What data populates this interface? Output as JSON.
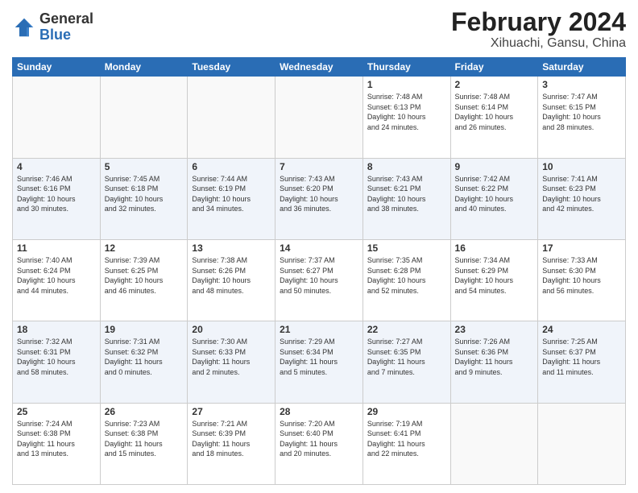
{
  "header": {
    "logo_general": "General",
    "logo_blue": "Blue",
    "title": "February 2024",
    "subtitle": "Xihuachi, Gansu, China"
  },
  "days_of_week": [
    "Sunday",
    "Monday",
    "Tuesday",
    "Wednesday",
    "Thursday",
    "Friday",
    "Saturday"
  ],
  "weeks": [
    {
      "stripe": false,
      "days": [
        {
          "num": "",
          "info": ""
        },
        {
          "num": "",
          "info": ""
        },
        {
          "num": "",
          "info": ""
        },
        {
          "num": "",
          "info": ""
        },
        {
          "num": "1",
          "info": "Sunrise: 7:48 AM\nSunset: 6:13 PM\nDaylight: 10 hours\nand 24 minutes."
        },
        {
          "num": "2",
          "info": "Sunrise: 7:48 AM\nSunset: 6:14 PM\nDaylight: 10 hours\nand 26 minutes."
        },
        {
          "num": "3",
          "info": "Sunrise: 7:47 AM\nSunset: 6:15 PM\nDaylight: 10 hours\nand 28 minutes."
        }
      ]
    },
    {
      "stripe": true,
      "days": [
        {
          "num": "4",
          "info": "Sunrise: 7:46 AM\nSunset: 6:16 PM\nDaylight: 10 hours\nand 30 minutes."
        },
        {
          "num": "5",
          "info": "Sunrise: 7:45 AM\nSunset: 6:18 PM\nDaylight: 10 hours\nand 32 minutes."
        },
        {
          "num": "6",
          "info": "Sunrise: 7:44 AM\nSunset: 6:19 PM\nDaylight: 10 hours\nand 34 minutes."
        },
        {
          "num": "7",
          "info": "Sunrise: 7:43 AM\nSunset: 6:20 PM\nDaylight: 10 hours\nand 36 minutes."
        },
        {
          "num": "8",
          "info": "Sunrise: 7:43 AM\nSunset: 6:21 PM\nDaylight: 10 hours\nand 38 minutes."
        },
        {
          "num": "9",
          "info": "Sunrise: 7:42 AM\nSunset: 6:22 PM\nDaylight: 10 hours\nand 40 minutes."
        },
        {
          "num": "10",
          "info": "Sunrise: 7:41 AM\nSunset: 6:23 PM\nDaylight: 10 hours\nand 42 minutes."
        }
      ]
    },
    {
      "stripe": false,
      "days": [
        {
          "num": "11",
          "info": "Sunrise: 7:40 AM\nSunset: 6:24 PM\nDaylight: 10 hours\nand 44 minutes."
        },
        {
          "num": "12",
          "info": "Sunrise: 7:39 AM\nSunset: 6:25 PM\nDaylight: 10 hours\nand 46 minutes."
        },
        {
          "num": "13",
          "info": "Sunrise: 7:38 AM\nSunset: 6:26 PM\nDaylight: 10 hours\nand 48 minutes."
        },
        {
          "num": "14",
          "info": "Sunrise: 7:37 AM\nSunset: 6:27 PM\nDaylight: 10 hours\nand 50 minutes."
        },
        {
          "num": "15",
          "info": "Sunrise: 7:35 AM\nSunset: 6:28 PM\nDaylight: 10 hours\nand 52 minutes."
        },
        {
          "num": "16",
          "info": "Sunrise: 7:34 AM\nSunset: 6:29 PM\nDaylight: 10 hours\nand 54 minutes."
        },
        {
          "num": "17",
          "info": "Sunrise: 7:33 AM\nSunset: 6:30 PM\nDaylight: 10 hours\nand 56 minutes."
        }
      ]
    },
    {
      "stripe": true,
      "days": [
        {
          "num": "18",
          "info": "Sunrise: 7:32 AM\nSunset: 6:31 PM\nDaylight: 10 hours\nand 58 minutes."
        },
        {
          "num": "19",
          "info": "Sunrise: 7:31 AM\nSunset: 6:32 PM\nDaylight: 11 hours\nand 0 minutes."
        },
        {
          "num": "20",
          "info": "Sunrise: 7:30 AM\nSunset: 6:33 PM\nDaylight: 11 hours\nand 2 minutes."
        },
        {
          "num": "21",
          "info": "Sunrise: 7:29 AM\nSunset: 6:34 PM\nDaylight: 11 hours\nand 5 minutes."
        },
        {
          "num": "22",
          "info": "Sunrise: 7:27 AM\nSunset: 6:35 PM\nDaylight: 11 hours\nand 7 minutes."
        },
        {
          "num": "23",
          "info": "Sunrise: 7:26 AM\nSunset: 6:36 PM\nDaylight: 11 hours\nand 9 minutes."
        },
        {
          "num": "24",
          "info": "Sunrise: 7:25 AM\nSunset: 6:37 PM\nDaylight: 11 hours\nand 11 minutes."
        }
      ]
    },
    {
      "stripe": false,
      "days": [
        {
          "num": "25",
          "info": "Sunrise: 7:24 AM\nSunset: 6:38 PM\nDaylight: 11 hours\nand 13 minutes."
        },
        {
          "num": "26",
          "info": "Sunrise: 7:23 AM\nSunset: 6:38 PM\nDaylight: 11 hours\nand 15 minutes."
        },
        {
          "num": "27",
          "info": "Sunrise: 7:21 AM\nSunset: 6:39 PM\nDaylight: 11 hours\nand 18 minutes."
        },
        {
          "num": "28",
          "info": "Sunrise: 7:20 AM\nSunset: 6:40 PM\nDaylight: 11 hours\nand 20 minutes."
        },
        {
          "num": "29",
          "info": "Sunrise: 7:19 AM\nSunset: 6:41 PM\nDaylight: 11 hours\nand 22 minutes."
        },
        {
          "num": "",
          "info": ""
        },
        {
          "num": "",
          "info": ""
        }
      ]
    }
  ]
}
